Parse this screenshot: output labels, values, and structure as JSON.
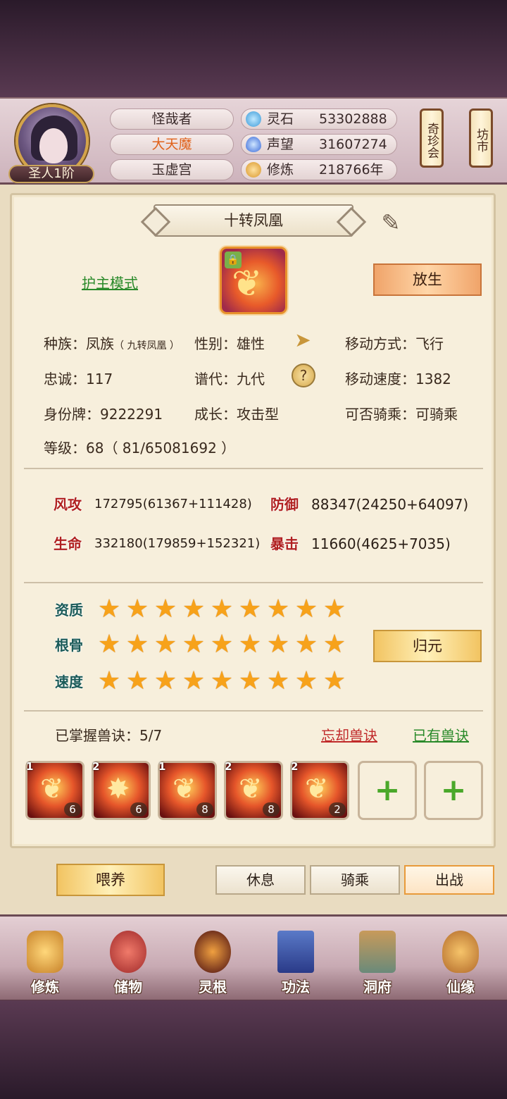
{
  "header": {
    "rank": "圣人1阶",
    "info_pills": [
      "怪哉者",
      "大天魔",
      "玉虚宫"
    ],
    "resources": [
      {
        "icon": "crystal-icon",
        "label": "灵石",
        "value": "53302888"
      },
      {
        "icon": "reputation-flame-icon",
        "label": "声望",
        "value": "31607274"
      },
      {
        "icon": "cultivation-icon",
        "label": "修炼",
        "value": "218766年"
      }
    ],
    "side_buttons": [
      "奇珍会",
      "坊市"
    ]
  },
  "pet": {
    "name": "十转凤凰",
    "guard_mode": "护主模式",
    "release": "放生",
    "attrs": {
      "race_label": "种族：",
      "race": "凤族",
      "race_sub": "（ 九转凤凰 ）",
      "gender": "性别：雄性",
      "move_type": "移动方式：飞行",
      "loyalty": "忠诚：117",
      "generation": "谱代：九代",
      "move_speed": "移动速度：1382",
      "id_tag": "身份牌：9222291",
      "growth": "成长：攻击型",
      "rideable": "可否骑乘：可骑乘",
      "level": "等级：68（ 81/65081692 ）"
    },
    "help_glyph": "?",
    "stats": [
      {
        "label": "风攻",
        "value": "172795(61367+111428)"
      },
      {
        "label": "防御",
        "value": "88347(24250+64097)"
      },
      {
        "label": "生命",
        "value": "332180(179859+152321)"
      },
      {
        "label": "暴击",
        "value": "11660(4625+7035)"
      }
    ],
    "aptitudes": [
      {
        "label": "资质",
        "stars": 9
      },
      {
        "label": "根骨",
        "stars": 9
      },
      {
        "label": "速度",
        "stars": 9
      }
    ],
    "reset": "归元",
    "skills_mastered": "已掌握兽诀：5/7",
    "forget_skill": "忘却兽诀",
    "owned_skills": "已有兽诀",
    "skills": [
      {
        "level": "1",
        "count": "6"
      },
      {
        "level": "2",
        "count": "6"
      },
      {
        "level": "1",
        "count": "8"
      },
      {
        "level": "2",
        "count": "8"
      },
      {
        "level": "2",
        "count": "2"
      }
    ],
    "add_glyph": "+"
  },
  "actions": {
    "feed": "喂养",
    "rest": "休息",
    "ride": "骑乘",
    "battle": "出战"
  },
  "nav": [
    {
      "label": "修炼",
      "icon": "cultivation-monk-icon"
    },
    {
      "label": "储物",
      "icon": "storage-bag-icon"
    },
    {
      "label": "灵根",
      "icon": "spirit-root-icon"
    },
    {
      "label": "功法",
      "icon": "manual-book-icon"
    },
    {
      "label": "洞府",
      "icon": "cave-mansion-icon"
    },
    {
      "label": "仙缘",
      "icon": "gourd-icon"
    }
  ]
}
